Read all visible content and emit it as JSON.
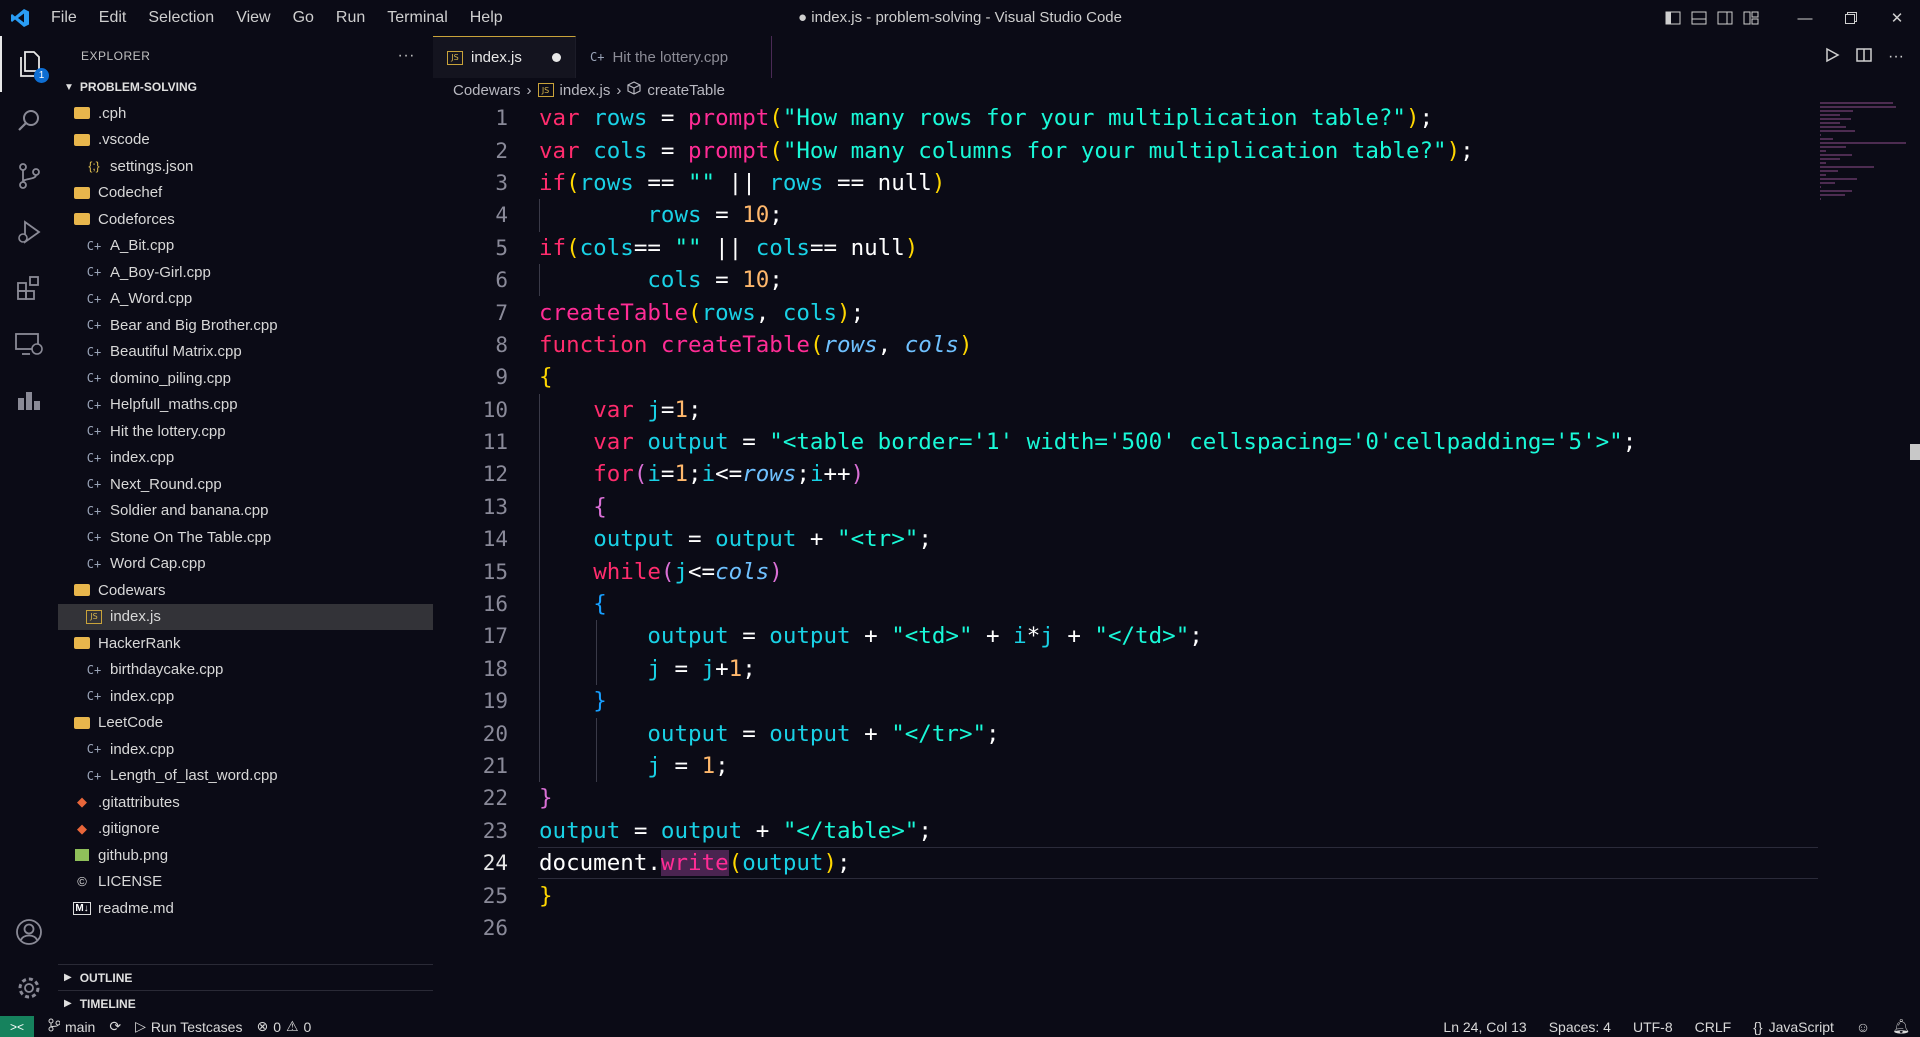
{
  "window": {
    "title": "● index.js - problem-solving - Visual Studio Code",
    "menu": [
      "File",
      "Edit",
      "Selection",
      "View",
      "Go",
      "Run",
      "Terminal",
      "Help"
    ]
  },
  "activity_bar": {
    "explorer_badge": "1",
    "icons": [
      "files-icon",
      "search-icon",
      "source-control-icon",
      "run-debug-icon",
      "extensions-icon",
      "remote-explorer-icon",
      "chart-icon"
    ]
  },
  "sidebar": {
    "header": "EXPLORER",
    "more_label": "···",
    "root": "PROBLEM-SOLVING",
    "items": [
      {
        "label": ".cph",
        "type": "folder",
        "indent": 0
      },
      {
        "label": ".vscode",
        "type": "folder",
        "indent": 0
      },
      {
        "label": "settings.json",
        "type": "json",
        "indent": 1
      },
      {
        "label": "Codechef",
        "type": "folder",
        "indent": 0
      },
      {
        "label": "Codeforces",
        "type": "folder",
        "indent": 0
      },
      {
        "label": "A_Bit.cpp",
        "type": "cpp",
        "indent": 1
      },
      {
        "label": "A_Boy-Girl.cpp",
        "type": "cpp",
        "indent": 1
      },
      {
        "label": "A_Word.cpp",
        "type": "cpp",
        "indent": 1
      },
      {
        "label": "Bear and Big Brother.cpp",
        "type": "cpp",
        "indent": 1
      },
      {
        "label": "Beautiful Matrix.cpp",
        "type": "cpp",
        "indent": 1
      },
      {
        "label": "domino_piling.cpp",
        "type": "cpp",
        "indent": 1
      },
      {
        "label": "Helpfull_maths.cpp",
        "type": "cpp",
        "indent": 1
      },
      {
        "label": "Hit the lottery.cpp",
        "type": "cpp",
        "indent": 1
      },
      {
        "label": "index.cpp",
        "type": "cpp",
        "indent": 1
      },
      {
        "label": "Next_Round.cpp",
        "type": "cpp",
        "indent": 1
      },
      {
        "label": "Soldier and banana.cpp",
        "type": "cpp",
        "indent": 1
      },
      {
        "label": "Stone On The Table.cpp",
        "type": "cpp",
        "indent": 1
      },
      {
        "label": "Word Cap.cpp",
        "type": "cpp",
        "indent": 1
      },
      {
        "label": "Codewars",
        "type": "folder",
        "indent": 0
      },
      {
        "label": "index.js",
        "type": "js",
        "indent": 1,
        "selected": true
      },
      {
        "label": "HackerRank",
        "type": "folder",
        "indent": 0
      },
      {
        "label": "birthdaycake.cpp",
        "type": "cpp",
        "indent": 1
      },
      {
        "label": "index.cpp",
        "type": "cpp",
        "indent": 1
      },
      {
        "label": "LeetCode",
        "type": "folder",
        "indent": 0
      },
      {
        "label": "index.cpp",
        "type": "cpp",
        "indent": 1
      },
      {
        "label": "Length_of_last_word.cpp",
        "type": "cpp",
        "indent": 1
      },
      {
        "label": ".gitattributes",
        "type": "git",
        "indent": 0
      },
      {
        "label": ".gitignore",
        "type": "git",
        "indent": 0
      },
      {
        "label": "github.png",
        "type": "image",
        "indent": 0
      },
      {
        "label": "LICENSE",
        "type": "license",
        "indent": 0
      },
      {
        "label": "readme.md",
        "type": "markdown",
        "indent": 0
      }
    ],
    "outline": "OUTLINE",
    "timeline": "TIMELINE"
  },
  "editor": {
    "tabs": [
      {
        "label": "index.js",
        "active": true,
        "dirty": true
      },
      {
        "label": "Hit the lottery.cpp",
        "active": false
      }
    ],
    "breadcrumb": [
      "Codewars",
      "index.js",
      "createTable"
    ],
    "current_line": 24,
    "lines": [
      [
        [
          "kw",
          "var"
        ],
        [
          "pl",
          " "
        ],
        [
          "var",
          "rows"
        ],
        [
          "op",
          " = "
        ],
        [
          "fn",
          "prompt"
        ],
        [
          "b1",
          "("
        ],
        [
          "str",
          "\"How many rows for your multiplication table?\""
        ],
        [
          "b1",
          ")"
        ],
        [
          "pl",
          ";"
        ]
      ],
      [
        [
          "kw",
          "var"
        ],
        [
          "pl",
          " "
        ],
        [
          "var",
          "cols"
        ],
        [
          "op",
          " = "
        ],
        [
          "fn",
          "prompt"
        ],
        [
          "b1",
          "("
        ],
        [
          "str",
          "\"How many columns for your multiplication table?\""
        ],
        [
          "b1",
          ")"
        ],
        [
          "pl",
          ";"
        ]
      ],
      [
        [
          "kw",
          "if"
        ],
        [
          "b1",
          "("
        ],
        [
          "var",
          "rows"
        ],
        [
          "op",
          " == "
        ],
        [
          "str",
          "\"\""
        ],
        [
          "op",
          " || "
        ],
        [
          "var",
          "rows"
        ],
        [
          "op",
          " == "
        ],
        [
          "op",
          "null"
        ],
        [
          "b1",
          ")"
        ]
      ],
      [
        [
          "pl",
          "        "
        ],
        [
          "var",
          "rows"
        ],
        [
          "op",
          " = "
        ],
        [
          "num",
          "10"
        ],
        [
          "pl",
          ";"
        ]
      ],
      [
        [
          "kw",
          "if"
        ],
        [
          "b1",
          "("
        ],
        [
          "var",
          "cols"
        ],
        [
          "op",
          "== "
        ],
        [
          "str",
          "\"\""
        ],
        [
          "op",
          " || "
        ],
        [
          "var",
          "cols"
        ],
        [
          "op",
          "== "
        ],
        [
          "op",
          "null"
        ],
        [
          "b1",
          ")"
        ]
      ],
      [
        [
          "pl",
          "        "
        ],
        [
          "var",
          "cols"
        ],
        [
          "op",
          " = "
        ],
        [
          "num",
          "10"
        ],
        [
          "pl",
          ";"
        ]
      ],
      [
        [
          "fn",
          "createTable"
        ],
        [
          "b1",
          "("
        ],
        [
          "var",
          "rows"
        ],
        [
          "pl",
          ", "
        ],
        [
          "var",
          "cols"
        ],
        [
          "b1",
          ")"
        ],
        [
          "pl",
          ";"
        ]
      ],
      [
        [
          "kw",
          "function"
        ],
        [
          "pl",
          " "
        ],
        [
          "fn",
          "createTable"
        ],
        [
          "b1",
          "("
        ],
        [
          "prm",
          "rows"
        ],
        [
          "pl",
          ", "
        ],
        [
          "prm",
          "cols"
        ],
        [
          "b1",
          ")"
        ]
      ],
      [
        [
          "b1",
          "{"
        ]
      ],
      [
        [
          "pl",
          "    "
        ],
        [
          "kw",
          "var"
        ],
        [
          "pl",
          " "
        ],
        [
          "var",
          "j"
        ],
        [
          "op",
          "="
        ],
        [
          "num",
          "1"
        ],
        [
          "pl",
          ";"
        ]
      ],
      [
        [
          "pl",
          "    "
        ],
        [
          "kw",
          "var"
        ],
        [
          "pl",
          " "
        ],
        [
          "var",
          "output"
        ],
        [
          "op",
          " = "
        ],
        [
          "str",
          "\"<table border='1' width='500' cellspacing='0'cellpadding='5'>\""
        ],
        [
          "pl",
          ";"
        ]
      ],
      [
        [
          "pl",
          "    "
        ],
        [
          "kw",
          "for"
        ],
        [
          "b2",
          "("
        ],
        [
          "var",
          "i"
        ],
        [
          "op",
          "="
        ],
        [
          "num",
          "1"
        ],
        [
          "pl",
          ";"
        ],
        [
          "var",
          "i"
        ],
        [
          "op",
          "<="
        ],
        [
          "prm",
          "rows"
        ],
        [
          "pl",
          ";"
        ],
        [
          "var",
          "i"
        ],
        [
          "op",
          "++"
        ],
        [
          "b2",
          ")"
        ]
      ],
      [
        [
          "pl",
          "    "
        ],
        [
          "b2",
          "{"
        ]
      ],
      [
        [
          "pl",
          "    "
        ],
        [
          "var",
          "output"
        ],
        [
          "op",
          " = "
        ],
        [
          "var",
          "output"
        ],
        [
          "op",
          " + "
        ],
        [
          "str",
          "\"<tr>\""
        ],
        [
          "pl",
          ";"
        ]
      ],
      [
        [
          "pl",
          "    "
        ],
        [
          "kw",
          "while"
        ],
        [
          "b2",
          "("
        ],
        [
          "var",
          "j"
        ],
        [
          "op",
          "<="
        ],
        [
          "prm",
          "cols"
        ],
        [
          "b2",
          ")"
        ]
      ],
      [
        [
          "pl",
          "    "
        ],
        [
          "b3",
          "{"
        ]
      ],
      [
        [
          "pl",
          "        "
        ],
        [
          "var",
          "output"
        ],
        [
          "op",
          " = "
        ],
        [
          "var",
          "output"
        ],
        [
          "op",
          " + "
        ],
        [
          "str",
          "\"<td>\""
        ],
        [
          "op",
          " + "
        ],
        [
          "var",
          "i"
        ],
        [
          "op",
          "*"
        ],
        [
          "var",
          "j"
        ],
        [
          "op",
          " + "
        ],
        [
          "str",
          "\"</td>\""
        ],
        [
          "pl",
          ";"
        ]
      ],
      [
        [
          "pl",
          "        "
        ],
        [
          "var",
          "j"
        ],
        [
          "op",
          " = "
        ],
        [
          "var",
          "j"
        ],
        [
          "op",
          "+"
        ],
        [
          "num",
          "1"
        ],
        [
          "pl",
          ";"
        ]
      ],
      [
        [
          "pl",
          "    "
        ],
        [
          "b3",
          "}"
        ]
      ],
      [
        [
          "pl",
          "        "
        ],
        [
          "var",
          "output"
        ],
        [
          "op",
          " = "
        ],
        [
          "var",
          "output"
        ],
        [
          "op",
          " + "
        ],
        [
          "str",
          "\"</tr>\""
        ],
        [
          "pl",
          ";"
        ]
      ],
      [
        [
          "pl",
          "        "
        ],
        [
          "var",
          "j"
        ],
        [
          "op",
          " = "
        ],
        [
          "num",
          "1"
        ],
        [
          "pl",
          ";"
        ]
      ],
      [
        [
          "b2",
          "}"
        ]
      ],
      [
        [
          "var",
          "output"
        ],
        [
          "op",
          " = "
        ],
        [
          "var",
          "output"
        ],
        [
          "op",
          " + "
        ],
        [
          "str",
          "\"</table>\""
        ],
        [
          "pl",
          ";"
        ]
      ],
      [
        [
          "pl",
          "document"
        ],
        [
          "pl",
          "."
        ],
        [
          "fnhl",
          "write"
        ],
        [
          "b1",
          "("
        ],
        [
          "var",
          "output"
        ],
        [
          "b1",
          ")"
        ],
        [
          "pl",
          ";"
        ]
      ],
      [
        [
          "b1",
          "}"
        ]
      ],
      []
    ]
  },
  "statusbar": {
    "remote_icon": "remote-icon",
    "branch": "main",
    "run_testcases": "Run Testcases",
    "errors": "0",
    "warnings": "0",
    "position": "Ln 24, Col 13",
    "spaces": "Spaces: 4",
    "encoding": "UTF-8",
    "eol": "CRLF",
    "language": "JavaScript"
  }
}
